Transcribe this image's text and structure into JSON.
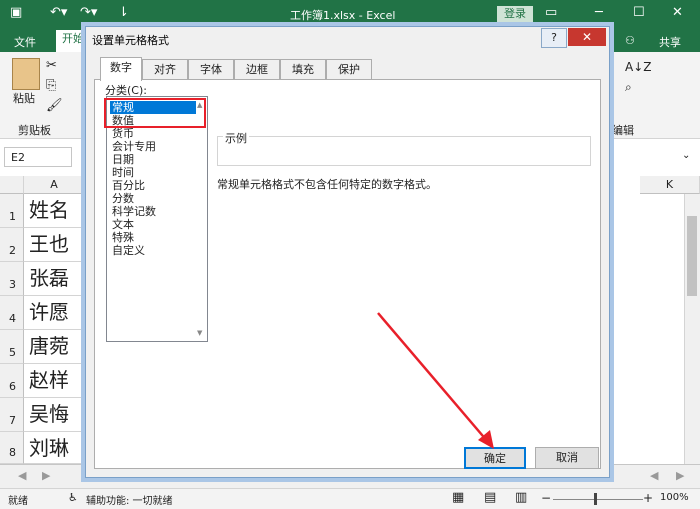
{
  "titlebar": {
    "title": "工作簿1.xlsx  -  Excel",
    "login": "登录"
  },
  "ribbon": {
    "tabs": [
      "文件",
      "开始"
    ],
    "share": "共享",
    "paste": "粘贴",
    "clipboard_group": "剪贴板",
    "edit_group": "编辑"
  },
  "namebox": "E2",
  "grid": {
    "col_a": "A",
    "col_k": "K",
    "rows": [
      {
        "n": "1",
        "a": "姓名"
      },
      {
        "n": "2",
        "a": "王也"
      },
      {
        "n": "3",
        "a": "张磊"
      },
      {
        "n": "4",
        "a": "许愿"
      },
      {
        "n": "5",
        "a": "唐菀"
      },
      {
        "n": "6",
        "a": "赵样"
      },
      {
        "n": "7",
        "a": "吴悔"
      },
      {
        "n": "8",
        "a": "刘琳"
      }
    ]
  },
  "statusbar": {
    "ready": "就绪",
    "accessibility": "辅助功能: 一切就绪",
    "zoom": "100%"
  },
  "dialog": {
    "title": "设置单元格格式",
    "help": "?",
    "tabs": [
      "数字",
      "对齐",
      "字体",
      "边框",
      "填充",
      "保护"
    ],
    "category_label": "分类(C):",
    "categories": [
      "常规",
      "数值",
      "货币",
      "会计专用",
      "日期",
      "时间",
      "百分比",
      "分数",
      "科学记数",
      "文本",
      "特殊",
      "自定义"
    ],
    "sample_label": "示例",
    "description": "常规单元格格式不包含任何特定的数字格式。",
    "ok": "确定",
    "cancel": "取消"
  },
  "colors": {
    "excel_green": "#217346",
    "highlight_red": "#e8202a",
    "select_blue": "#0078d7"
  }
}
